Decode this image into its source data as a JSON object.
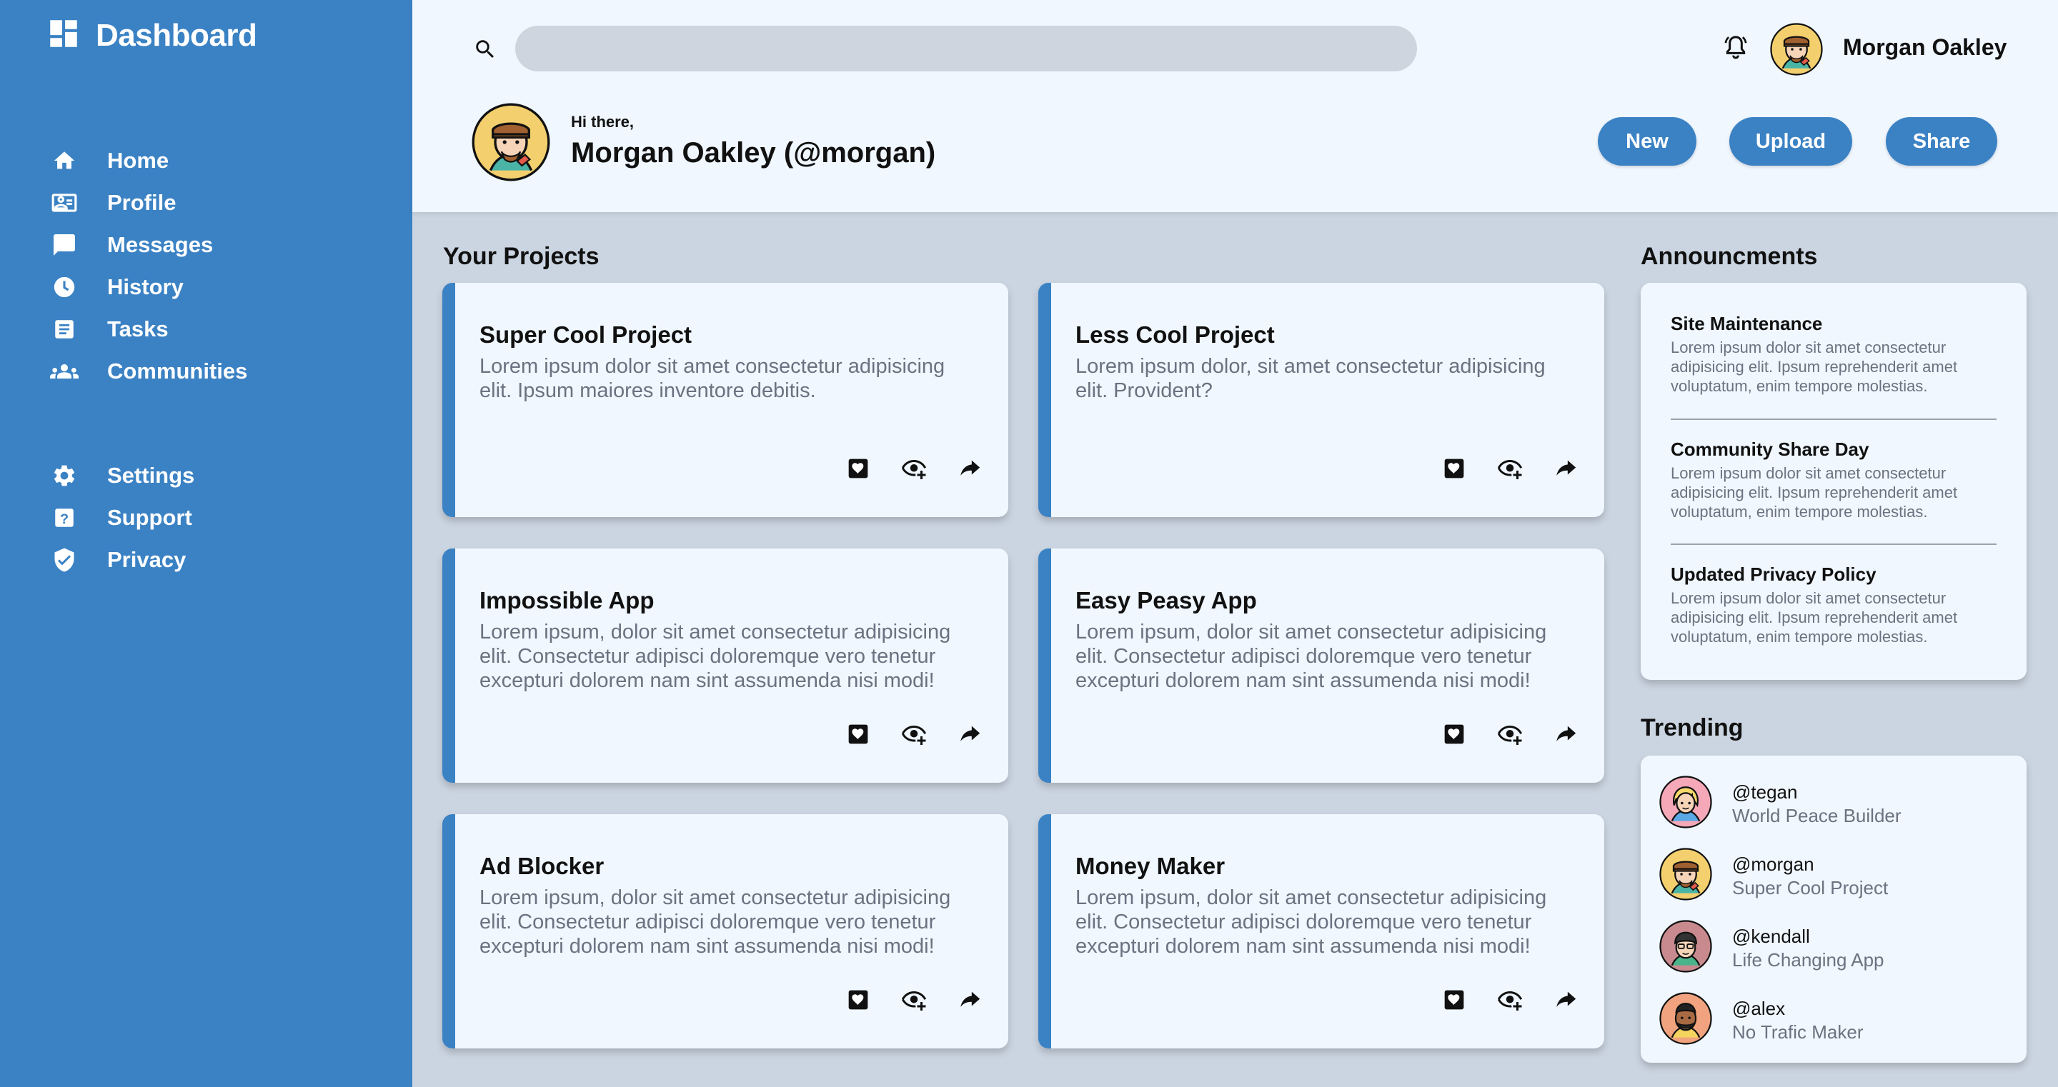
{
  "sidebar": {
    "brand": "Dashboard",
    "main_items": [
      {
        "label": "Home",
        "icon": "home-icon"
      },
      {
        "label": "Profile",
        "icon": "id-card-icon"
      },
      {
        "label": "Messages",
        "icon": "message-icon"
      },
      {
        "label": "History",
        "icon": "clock-icon"
      },
      {
        "label": "Tasks",
        "icon": "document-icon"
      },
      {
        "label": "Communities",
        "icon": "people-icon"
      }
    ],
    "secondary_items": [
      {
        "label": "Settings",
        "icon": "gear-icon"
      },
      {
        "label": "Support",
        "icon": "help-icon"
      },
      {
        "label": "Privacy",
        "icon": "shield-icon"
      }
    ]
  },
  "header": {
    "search_placeholder": "",
    "user_name": "Morgan Oakley",
    "greeting": "Hi there,",
    "display_name": "Morgan Oakley (@morgan)",
    "buttons": {
      "new": "New",
      "upload": "Upload",
      "share": "Share"
    }
  },
  "projects": {
    "title": "Your Projects",
    "items": [
      {
        "title": "Super Cool Project",
        "desc": "Lorem ipsum dolor sit amet consectetur adipisicing elit. Ipsum maiores inventore debitis."
      },
      {
        "title": "Less Cool Project",
        "desc": "Lorem ipsum dolor, sit amet consectetur adipisicing elit. Provident?"
      },
      {
        "title": "Impossible App",
        "desc": "Lorem ipsum, dolor sit amet consectetur adipisicing elit. Consectetur adipisci doloremque vero tenetur excepturi dolorem nam sint assumenda nisi modi!"
      },
      {
        "title": "Easy Peasy App",
        "desc": "Lorem ipsum, dolor sit amet consectetur adipisicing elit. Consectetur adipisci doloremque vero tenetur excepturi dolorem nam sint assumenda nisi modi!"
      },
      {
        "title": "Ad Blocker",
        "desc": "Lorem ipsum, dolor sit amet consectetur adipisicing elit. Consectetur adipisci doloremque vero tenetur excepturi dolorem nam sint assumenda nisi modi!"
      },
      {
        "title": "Money Maker",
        "desc": "Lorem ipsum, dolor sit amet consectetur adipisicing elit. Consectetur adipisci doloremque vero tenetur excepturi dolorem nam sint assumenda nisi modi!"
      }
    ]
  },
  "announcements": {
    "title": "Announcments",
    "items": [
      {
        "title": "Site Maintenance",
        "body": "Lorem ipsum dolor sit amet consectetur adipisicing elit. Ipsum reprehenderit amet voluptatum, enim tempore molestias."
      },
      {
        "title": "Community Share Day",
        "body": "Lorem ipsum dolor sit amet consectetur adipisicing elit. Ipsum reprehenderit amet voluptatum, enim tempore molestias."
      },
      {
        "title": "Updated Privacy Policy",
        "body": "Lorem ipsum dolor sit amet consectetur adipisicing elit. Ipsum reprehenderit amet voluptatum, enim tempore molestias."
      }
    ]
  },
  "trending": {
    "title": "Trending",
    "items": [
      {
        "handle": "@tegan",
        "sub": "World Peace Builder"
      },
      {
        "handle": "@morgan",
        "sub": "Super Cool Project"
      },
      {
        "handle": "@kendall",
        "sub": "Life Changing App"
      },
      {
        "handle": "@alex",
        "sub": "No Trafic Maker"
      }
    ]
  },
  "colors": {
    "accent": "#3b82c4",
    "background": "#cbd5e1",
    "panel": "#f0f7ff"
  }
}
